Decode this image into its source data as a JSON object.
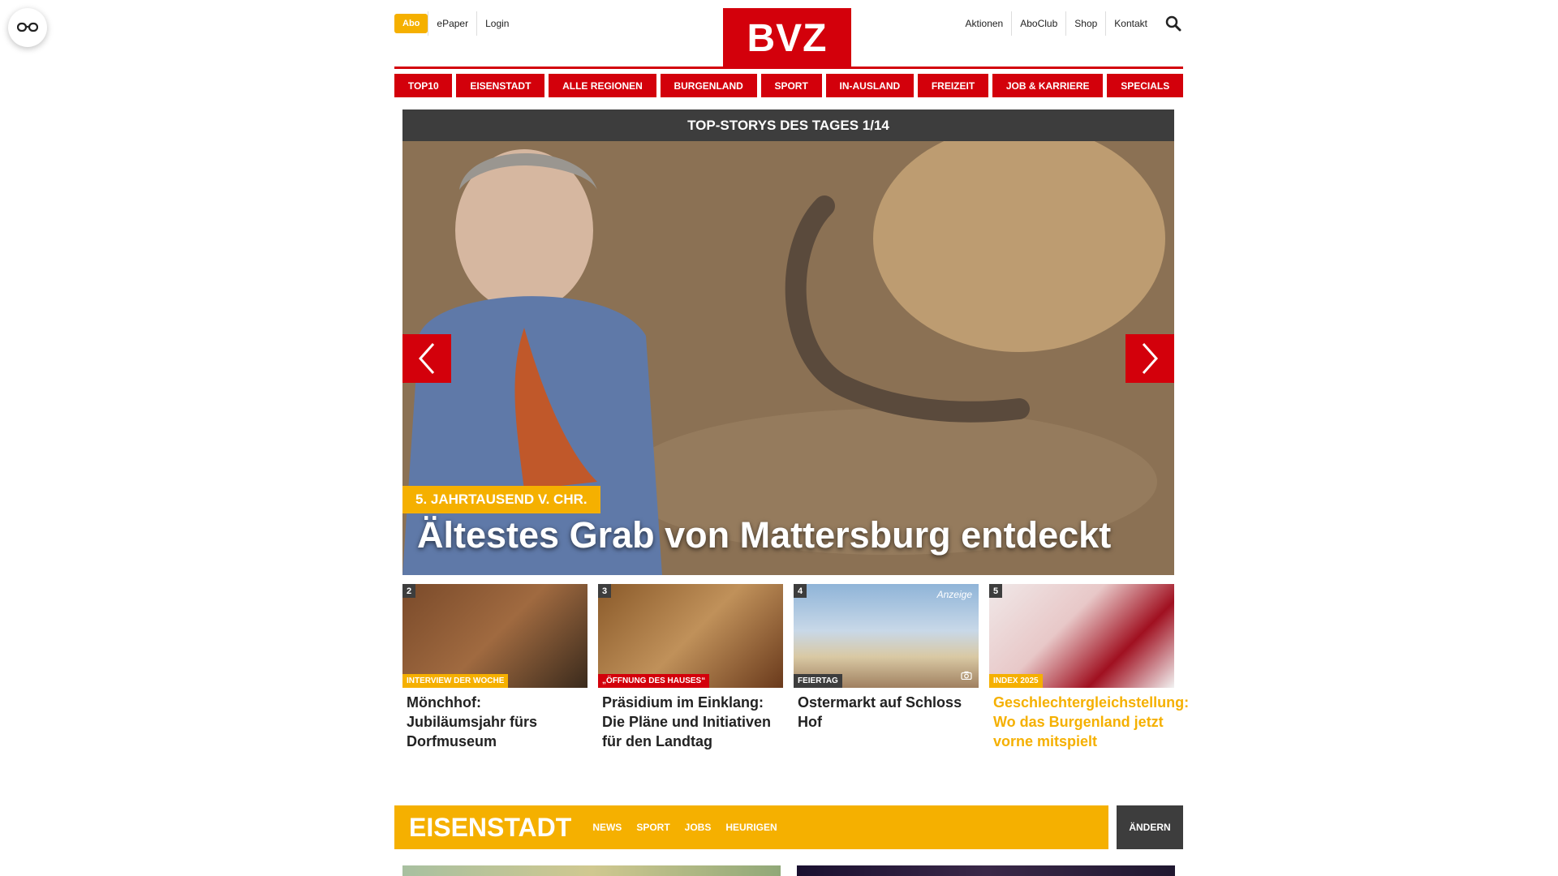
{
  "header": {
    "abo_label": "Abo",
    "util_left": [
      "ePaper",
      "Login"
    ],
    "logo_text": "BVZ",
    "util_right": [
      "Aktionen",
      "AboClub",
      "Shop",
      "Kontakt"
    ]
  },
  "nav": {
    "items": [
      "TOP10",
      "EISENSTADT",
      "ALLE REGIONEN",
      "BURGENLAND",
      "SPORT",
      "IN-AUSLAND",
      "FREIZEIT",
      "JOB & KARRIERE",
      "SPECIALS"
    ]
  },
  "carousel": {
    "heading": "TOP-STORYS DES TAGES 1/14",
    "kicker": "5. JAHRTAUSEND V. CHR.",
    "title": "Ältestes Grab von Mattersburg entdeckt"
  },
  "stories": [
    {
      "num": "2",
      "kicker": "INTERVIEW DER WOCHE",
      "title": "Mönchhof: Jubiläumsjahr fürs Dorfmuseum",
      "kicker_color": "#f5b000"
    },
    {
      "num": "3",
      "kicker": "„ÖFFNUNG DES HAUSES“",
      "title": "Präsidium im Einklang: Die Pläne und Initiativen für den Landtag",
      "kicker_color": "#d3000b"
    },
    {
      "num": "4",
      "kicker": "FEIERTAG",
      "title": "Ostermarkt auf Schloss Hof",
      "kicker_color": "#3d3d3d",
      "anzeige": "Anzeige"
    },
    {
      "num": "5",
      "kicker": "INDEX 2025",
      "title": "Geschlechtergleichstellung: Wo das Burgenland jetzt vorne mitspielt",
      "kicker_color": "#f5b000"
    }
  ],
  "section": {
    "title": "EISENSTADT",
    "links": [
      "NEWS",
      "SPORT",
      "JOBS",
      "HEURIGEN"
    ],
    "change_label": "ÄNDERN"
  },
  "colors": {
    "brand_red": "#d3000b",
    "accent_yellow": "#f5b000",
    "dark_gray": "#3d3d3d"
  }
}
